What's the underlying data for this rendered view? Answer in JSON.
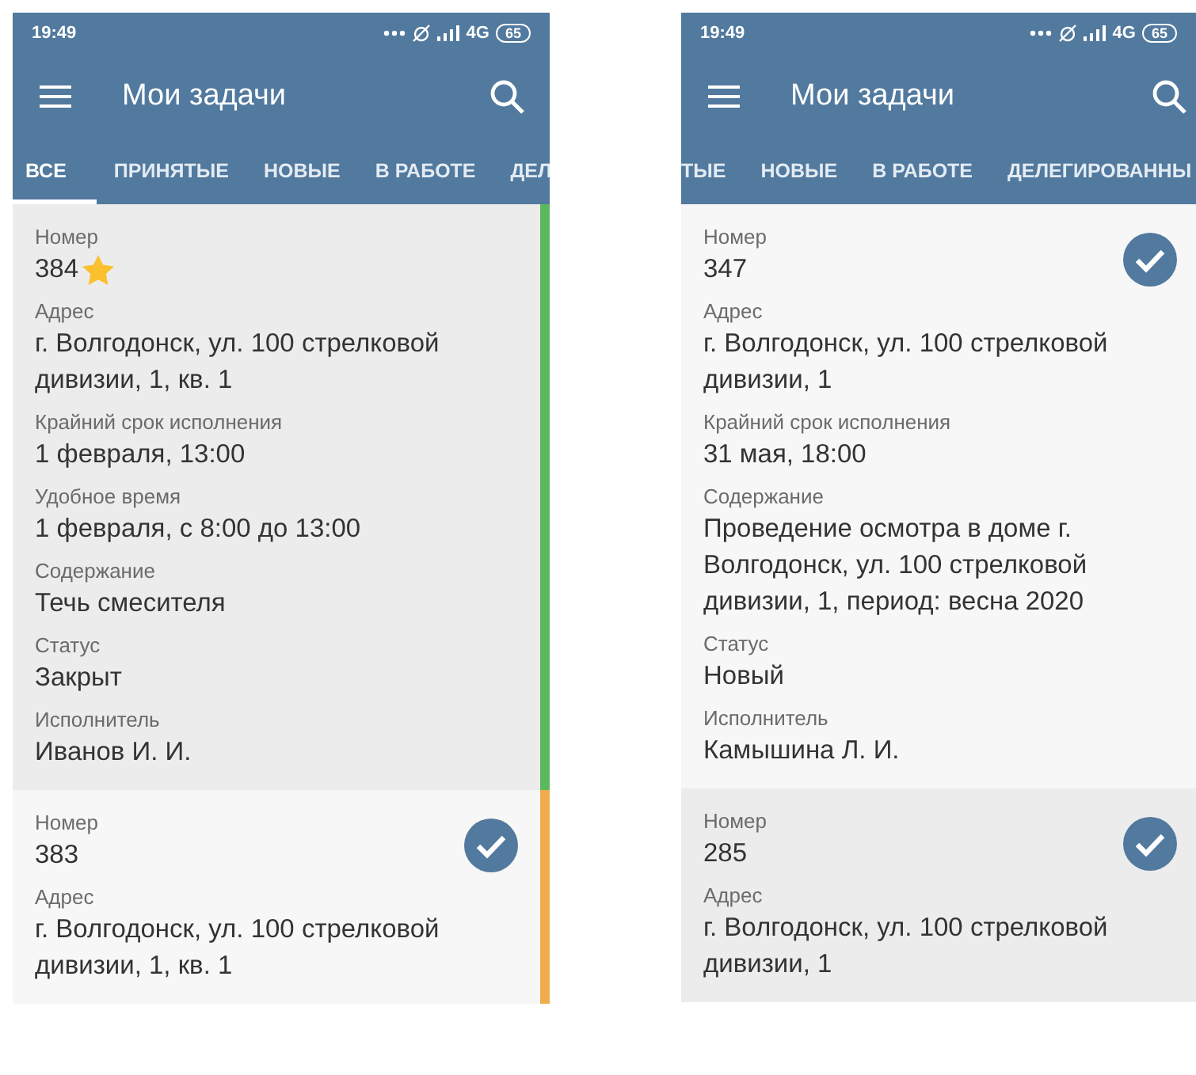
{
  "phones": [
    {
      "status_bar": {
        "time": "19:49",
        "network": "4G",
        "battery": "65"
      },
      "toolbar": {
        "title": "Мои задачи"
      },
      "tabs": [
        {
          "label": "ВСЕ",
          "selected": true
        },
        {
          "label": "ПРИНЯТЫЕ",
          "selected": false
        },
        {
          "label": "НОВЫЕ",
          "selected": false
        },
        {
          "label": "В РАБОТЕ",
          "selected": false
        },
        {
          "label": "ДЕЛ",
          "selected": false
        }
      ],
      "cards": [
        {
          "selected": true,
          "color": "#5cb85c",
          "starred": true,
          "checked": false,
          "fields": [
            {
              "label": "Номер",
              "value": "384"
            },
            {
              "label": "Адрес",
              "value": "г. Волгодонск, ул. 100 стрелковой дивизии, 1, кв. 1"
            },
            {
              "label": "Крайний срок исполнения",
              "value": "1 февраля, 13:00"
            },
            {
              "label": "Удобное время",
              "value": "1 февраля, с 8:00 до 13:00"
            },
            {
              "label": "Содержание",
              "value": "Течь смесителя"
            },
            {
              "label": "Статус",
              "value": "Закрыт"
            },
            {
              "label": "Исполнитель",
              "value": "Иванов И. И."
            }
          ]
        },
        {
          "selected": false,
          "color": "#f0ad4e",
          "starred": false,
          "checked": true,
          "fields": [
            {
              "label": "Номер",
              "value": "383"
            },
            {
              "label": "Адрес",
              "value": "г. Волгодонск, ул. 100 стрелковой дивизии, 1, кв. 1"
            }
          ]
        }
      ]
    },
    {
      "status_bar": {
        "time": "19:49",
        "network": "4G",
        "battery": "65"
      },
      "toolbar": {
        "title": "Мои задачи"
      },
      "tabs": [
        {
          "label": "ТЫЕ",
          "selected": false
        },
        {
          "label": "НОВЫЕ",
          "selected": false
        },
        {
          "label": "В РАБОТЕ",
          "selected": false
        },
        {
          "label": "ДЕЛЕГИРОВАННЫ",
          "selected": false
        }
      ],
      "cards": [
        {
          "selected": false,
          "starred": false,
          "checked": true,
          "fields": [
            {
              "label": "Номер",
              "value": "347"
            },
            {
              "label": "Адрес",
              "value": "г. Волгодонск, ул. 100 стрелковой дивизии, 1"
            },
            {
              "label": "Крайний срок исполнения",
              "value": "31 мая, 18:00"
            },
            {
              "label": "Содержание",
              "value": "Проведение осмотра в доме г. Волгодонск, ул. 100 стрелковой дивизии, 1, период: весна 2020"
            },
            {
              "label": "Статус",
              "value": "Новый"
            },
            {
              "label": "Исполнитель",
              "value": "Камышина Л. И."
            }
          ]
        },
        {
          "selected": true,
          "starred": false,
          "checked": true,
          "fields": [
            {
              "label": "Номер",
              "value": "285"
            },
            {
              "label": "Адрес",
              "value": "г. Волгодонск, ул. 100 стрелковой дивизии, 1"
            }
          ]
        }
      ]
    }
  ]
}
